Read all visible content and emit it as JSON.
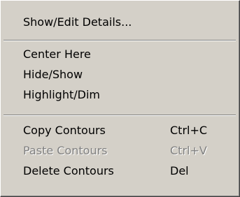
{
  "menu": {
    "items": [
      {
        "label": "Show/Edit Details...",
        "shortcut": "",
        "enabled": true
      },
      {
        "label": "Center Here",
        "shortcut": "",
        "enabled": true
      },
      {
        "label": "Hide/Show",
        "shortcut": "",
        "enabled": true
      },
      {
        "label": "Highlight/Dim",
        "shortcut": "",
        "enabled": true
      },
      {
        "label": "Copy Contours",
        "shortcut": "Ctrl+C",
        "enabled": true
      },
      {
        "label": "Paste Contours",
        "shortcut": "Ctrl+V",
        "enabled": false
      },
      {
        "label": "Delete Contours",
        "shortcut": "Del",
        "enabled": true
      }
    ],
    "colors": {
      "background": "#d4d0c8",
      "disabled_text": "#808080",
      "text": "#000000"
    }
  }
}
